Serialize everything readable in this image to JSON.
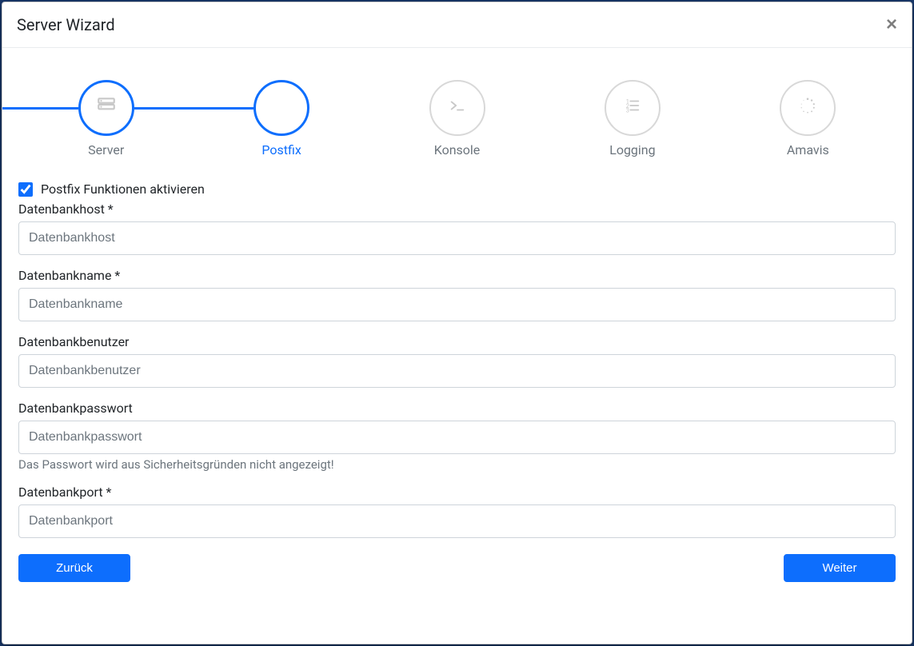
{
  "modal": {
    "title": "Server Wizard",
    "close_label": "×"
  },
  "steps": [
    {
      "label": "Server",
      "icon": "server-icon"
    },
    {
      "label": "Postfix",
      "icon": ""
    },
    {
      "label": "Konsole",
      "icon": "terminal-icon"
    },
    {
      "label": "Logging",
      "icon": "list-icon"
    },
    {
      "label": "Amavis",
      "icon": "spinner-icon"
    }
  ],
  "form": {
    "activate": {
      "label": "Postfix Funktionen aktivieren",
      "checked": true
    },
    "db_host": {
      "label": "Datenbankhost *",
      "placeholder": "Datenbankhost",
      "value": ""
    },
    "db_name": {
      "label": "Datenbankname *",
      "placeholder": "Datenbankname",
      "value": ""
    },
    "db_user": {
      "label": "Datenbankbenutzer",
      "placeholder": "Datenbankbenutzer",
      "value": ""
    },
    "db_pass": {
      "label": "Datenbankpasswort",
      "placeholder": "Datenbankpasswort",
      "value": "",
      "help": "Das Passwort wird aus Sicherheitsgründen nicht angezeigt!"
    },
    "db_port": {
      "label": "Datenbankport *",
      "placeholder": "Datenbankport",
      "value": ""
    }
  },
  "buttons": {
    "back": "Zurück",
    "next": "Weiter"
  }
}
